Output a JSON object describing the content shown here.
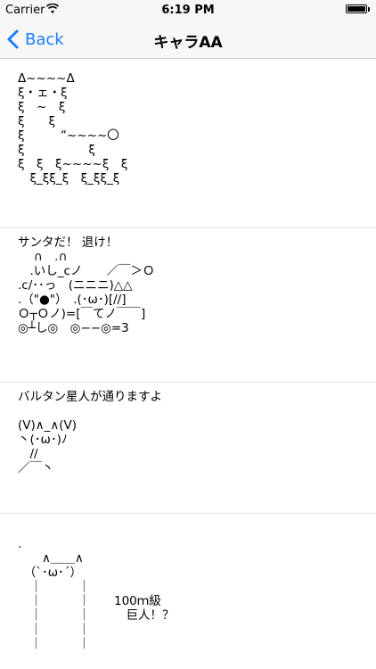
{
  "status_bar": {
    "carrier": "Carrier",
    "time": "6:19 PM",
    "battery_level": 1.0
  },
  "nav": {
    "back_label": "Back",
    "title": "キャラAA"
  },
  "arts": [
    {
      "text": "Δ~~~~Δ\nξ・ェ・ξ\nξ　~　ξ\nξ　　ξ\nξ　　　“~~~~〇\nξ　　　　　 ξ\nξ　ξ　ξ~~~~ξ　ξ\n　ξ_ξξ_ξ　ξ_ξξ_ξ"
    },
    {
      "text": "サンタだ！ 退け！\n　 ∩　.∩\n　.いし_cノ　　／￣＞Ｏ\n.c/･･っ　(ニニニ)△△\n.（\"●\"）　.(･ω･)[//]\nＯ┬Ｏノ)=[￣てノ￣￣]\n◎┴し◎　◎−−◎=3"
    },
    {
      "text": "バルタン星人が通りますよ\n\n(V)∧_∧(V)\n丶(･ω･)ﾉ\n　//\n／￣丶"
    },
    {
      "text": ".\n　　∧＿＿∧\n　（`･ω･´）\n　｜　　　｜\n　｜　　　｜　　100ｍ級\n　｜　　　｜　　　巨人！？\n　｜　　　｜\n　｜　　　｜"
    }
  ]
}
